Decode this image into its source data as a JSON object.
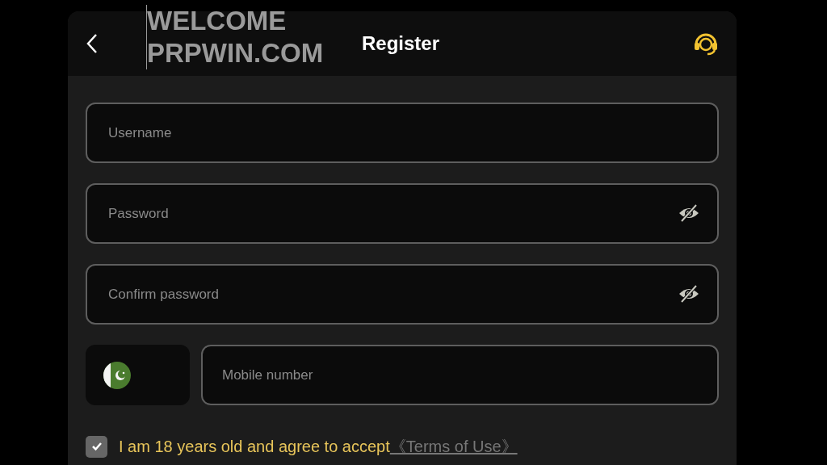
{
  "header": {
    "title": "Register"
  },
  "overlay_caption": [
    "WELCOME",
    "PRPWIN.COM"
  ],
  "fields": [
    {
      "placeholder": "Username",
      "kind": "text"
    },
    {
      "placeholder": "Password",
      "kind": "password"
    },
    {
      "placeholder": "Confirm password",
      "kind": "password"
    }
  ],
  "phone": {
    "placeholder": "Mobile number"
  },
  "agreement": {
    "checked": true,
    "text": "I am 18 years old and agree to accept",
    "link": "《Terms of Use》"
  }
}
